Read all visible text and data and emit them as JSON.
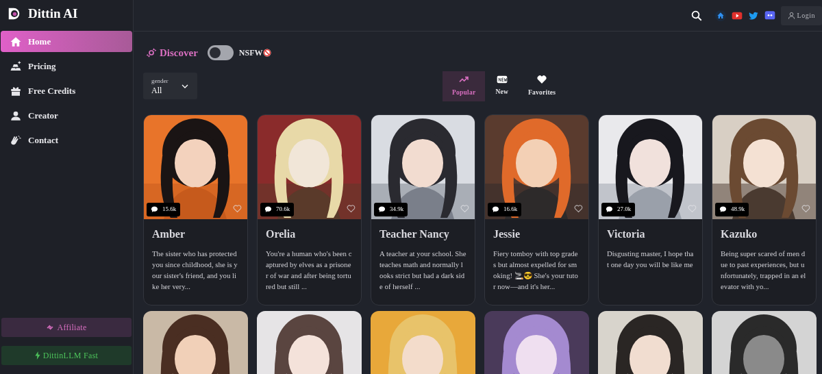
{
  "brand": {
    "name": "Dittin AI"
  },
  "sidebar": {
    "items": [
      {
        "label": "Home",
        "selected": true
      },
      {
        "label": "Pricing",
        "selected": false
      },
      {
        "label": "Free Credits",
        "selected": false
      },
      {
        "label": "Creator",
        "selected": false
      },
      {
        "label": "Contact",
        "selected": false
      }
    ],
    "buttons": [
      {
        "label": "Affiliate",
        "kind": "affiliate"
      },
      {
        "label": "DittinLLM Fast",
        "kind": "fast"
      }
    ]
  },
  "header": {
    "login": "Login"
  },
  "discover": {
    "title": "Discover",
    "nsfw": {
      "label": "NSFW",
      "on": false
    }
  },
  "filter": {
    "label": "gender",
    "value": "All"
  },
  "sort_tabs": [
    {
      "label": "Popular",
      "selected": true
    },
    {
      "label": "New",
      "selected": false
    },
    {
      "label": "Favorites",
      "selected": false
    }
  ],
  "cards": [
    {
      "kind": "character",
      "name": "Amber",
      "chats": "15.6k",
      "description": "The sister who has protected you since childhood, she is your sister's friend, and you like her very...",
      "favorite": false
    },
    {
      "kind": "character",
      "name": "Orelia",
      "chats": "70.6k",
      "description": "You're a human who's been captured by elves as a prisoner of war and after being tortured but still ...",
      "favorite": false
    },
    {
      "kind": "character",
      "name": "Teacher Nancy",
      "chats": "34.9k",
      "description": "A teacher at your school. She teaches math and normally looks strict but had a dark side of herself ...",
      "favorite": false
    },
    {
      "kind": "character",
      "name": "Jessie",
      "chats": "16.6k",
      "description": "Fiery tomboy with top grades but almost expelled for smoking! 🚬😎 She's your tutor now—and it's her...",
      "favorite": false
    },
    {
      "kind": "character",
      "name": "Victoria",
      "chats": "27.0k",
      "description": "Disgusting master, I hope that one day you will be like me",
      "favorite": false
    },
    {
      "kind": "character",
      "name": "Kazuko",
      "chats": "48.9k",
      "description": "Being super scared of men due to past experiences, but unfortunately, trapped in an elevator with yo...",
      "favorite": false
    },
    {
      "kind": "picture"
    },
    {
      "kind": "picture"
    },
    {
      "kind": "picture"
    },
    {
      "kind": "picture"
    },
    {
      "kind": "picture"
    },
    {
      "kind": "picture"
    }
  ]
}
